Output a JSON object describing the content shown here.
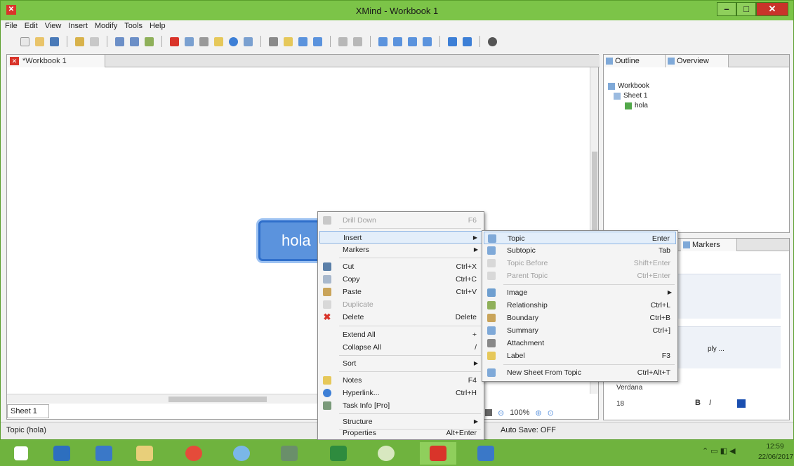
{
  "window": {
    "title": "XMind - Workbook 1",
    "app_icon": "xmind-icon",
    "min": "–",
    "max": "□",
    "close": "✕"
  },
  "menu": [
    "File",
    "Edit",
    "View",
    "Insert",
    "Modify",
    "Tools",
    "Help"
  ],
  "editor": {
    "tab_title": "*Workbook 1",
    "tab_icon": "xmind-icon",
    "topic_text": "hola",
    "sheet_tab": "Sheet 1",
    "zoom": "100%"
  },
  "outline": {
    "tabs": [
      "Outline",
      "Overview"
    ],
    "tree": [
      {
        "label": "Workbook",
        "icon": "workbook-icon"
      },
      {
        "label": "Sheet 1",
        "icon": "sheet-icon"
      },
      {
        "label": "hola",
        "icon": "topic-icon"
      }
    ]
  },
  "props": {
    "tab": "Markers",
    "apply_text": "ply ...",
    "font_name": "Verdana",
    "font_size": "18"
  },
  "status": {
    "left": "Topic (hola)",
    "autosave": "Auto Save: OFF"
  },
  "context_menu": [
    {
      "label": "Drill Down",
      "shortcut": "F6",
      "disabled": true,
      "icon": "drill-down-icon"
    },
    {
      "label": "Insert",
      "submenu": true,
      "highlight": true
    },
    {
      "label": "Markers",
      "submenu": true
    },
    {
      "label": "Cut",
      "shortcut": "Ctrl+X",
      "icon": "cut-icon"
    },
    {
      "label": "Copy",
      "shortcut": "Ctrl+C",
      "icon": "copy-icon"
    },
    {
      "label": "Paste",
      "shortcut": "Ctrl+V",
      "icon": "paste-icon"
    },
    {
      "label": "Duplicate",
      "disabled": true,
      "icon": "duplicate-icon"
    },
    {
      "label": "Delete",
      "shortcut": "Delete",
      "icon": "delete-icon"
    },
    {
      "label": "Extend All",
      "shortcut": "+"
    },
    {
      "label": "Collapse All",
      "shortcut": "/"
    },
    {
      "label": "Sort",
      "submenu": true
    },
    {
      "label": "Notes",
      "shortcut": "F4",
      "icon": "notes-icon"
    },
    {
      "label": "Hyperlink...",
      "shortcut": "Ctrl+H",
      "icon": "hyperlink-icon"
    },
    {
      "label": "Task Info [Pro]",
      "icon": "task-info-icon"
    },
    {
      "label": "Structure",
      "submenu": true
    },
    {
      "label": "Properties",
      "shortcut": "Alt+Enter"
    }
  ],
  "insert_submenu": [
    {
      "label": "Topic",
      "shortcut": "Enter",
      "highlight": true,
      "icon": "topic-icon"
    },
    {
      "label": "Subtopic",
      "shortcut": "Tab",
      "icon": "subtopic-icon"
    },
    {
      "label": "Topic Before",
      "shortcut": "Shift+Enter",
      "disabled": true,
      "icon": "topic-before-icon"
    },
    {
      "label": "Parent Topic",
      "shortcut": "Ctrl+Enter",
      "disabled": true,
      "icon": "parent-topic-icon"
    },
    {
      "label": "Image",
      "submenu": true,
      "icon": "image-icon"
    },
    {
      "label": "Relationship",
      "shortcut": "Ctrl+L",
      "icon": "relationship-icon"
    },
    {
      "label": "Boundary",
      "shortcut": "Ctrl+B",
      "icon": "boundary-icon"
    },
    {
      "label": "Summary",
      "shortcut": "Ctrl+]",
      "icon": "summary-icon"
    },
    {
      "label": "Attachment",
      "icon": "attachment-icon"
    },
    {
      "label": "Label",
      "shortcut": "F3",
      "icon": "label-icon"
    },
    {
      "label": "New Sheet From Topic",
      "shortcut": "Ctrl+Alt+T",
      "icon": "new-sheet-icon"
    }
  ],
  "taskbar": {
    "apps": [
      "start-icon",
      "file-explorer-icon",
      "steam-icon",
      "folder-icon",
      "chrome-icon",
      "paint-icon",
      "app-icon",
      "excel-icon",
      "green-app-icon",
      "xmind-icon",
      "language-icon"
    ],
    "time": "12:59",
    "date": "22/06/2017"
  },
  "colors": {
    "accent": "#6fb33e",
    "topic": "#5b93dd",
    "close": "#c9332a",
    "delete": "#d9342a"
  }
}
